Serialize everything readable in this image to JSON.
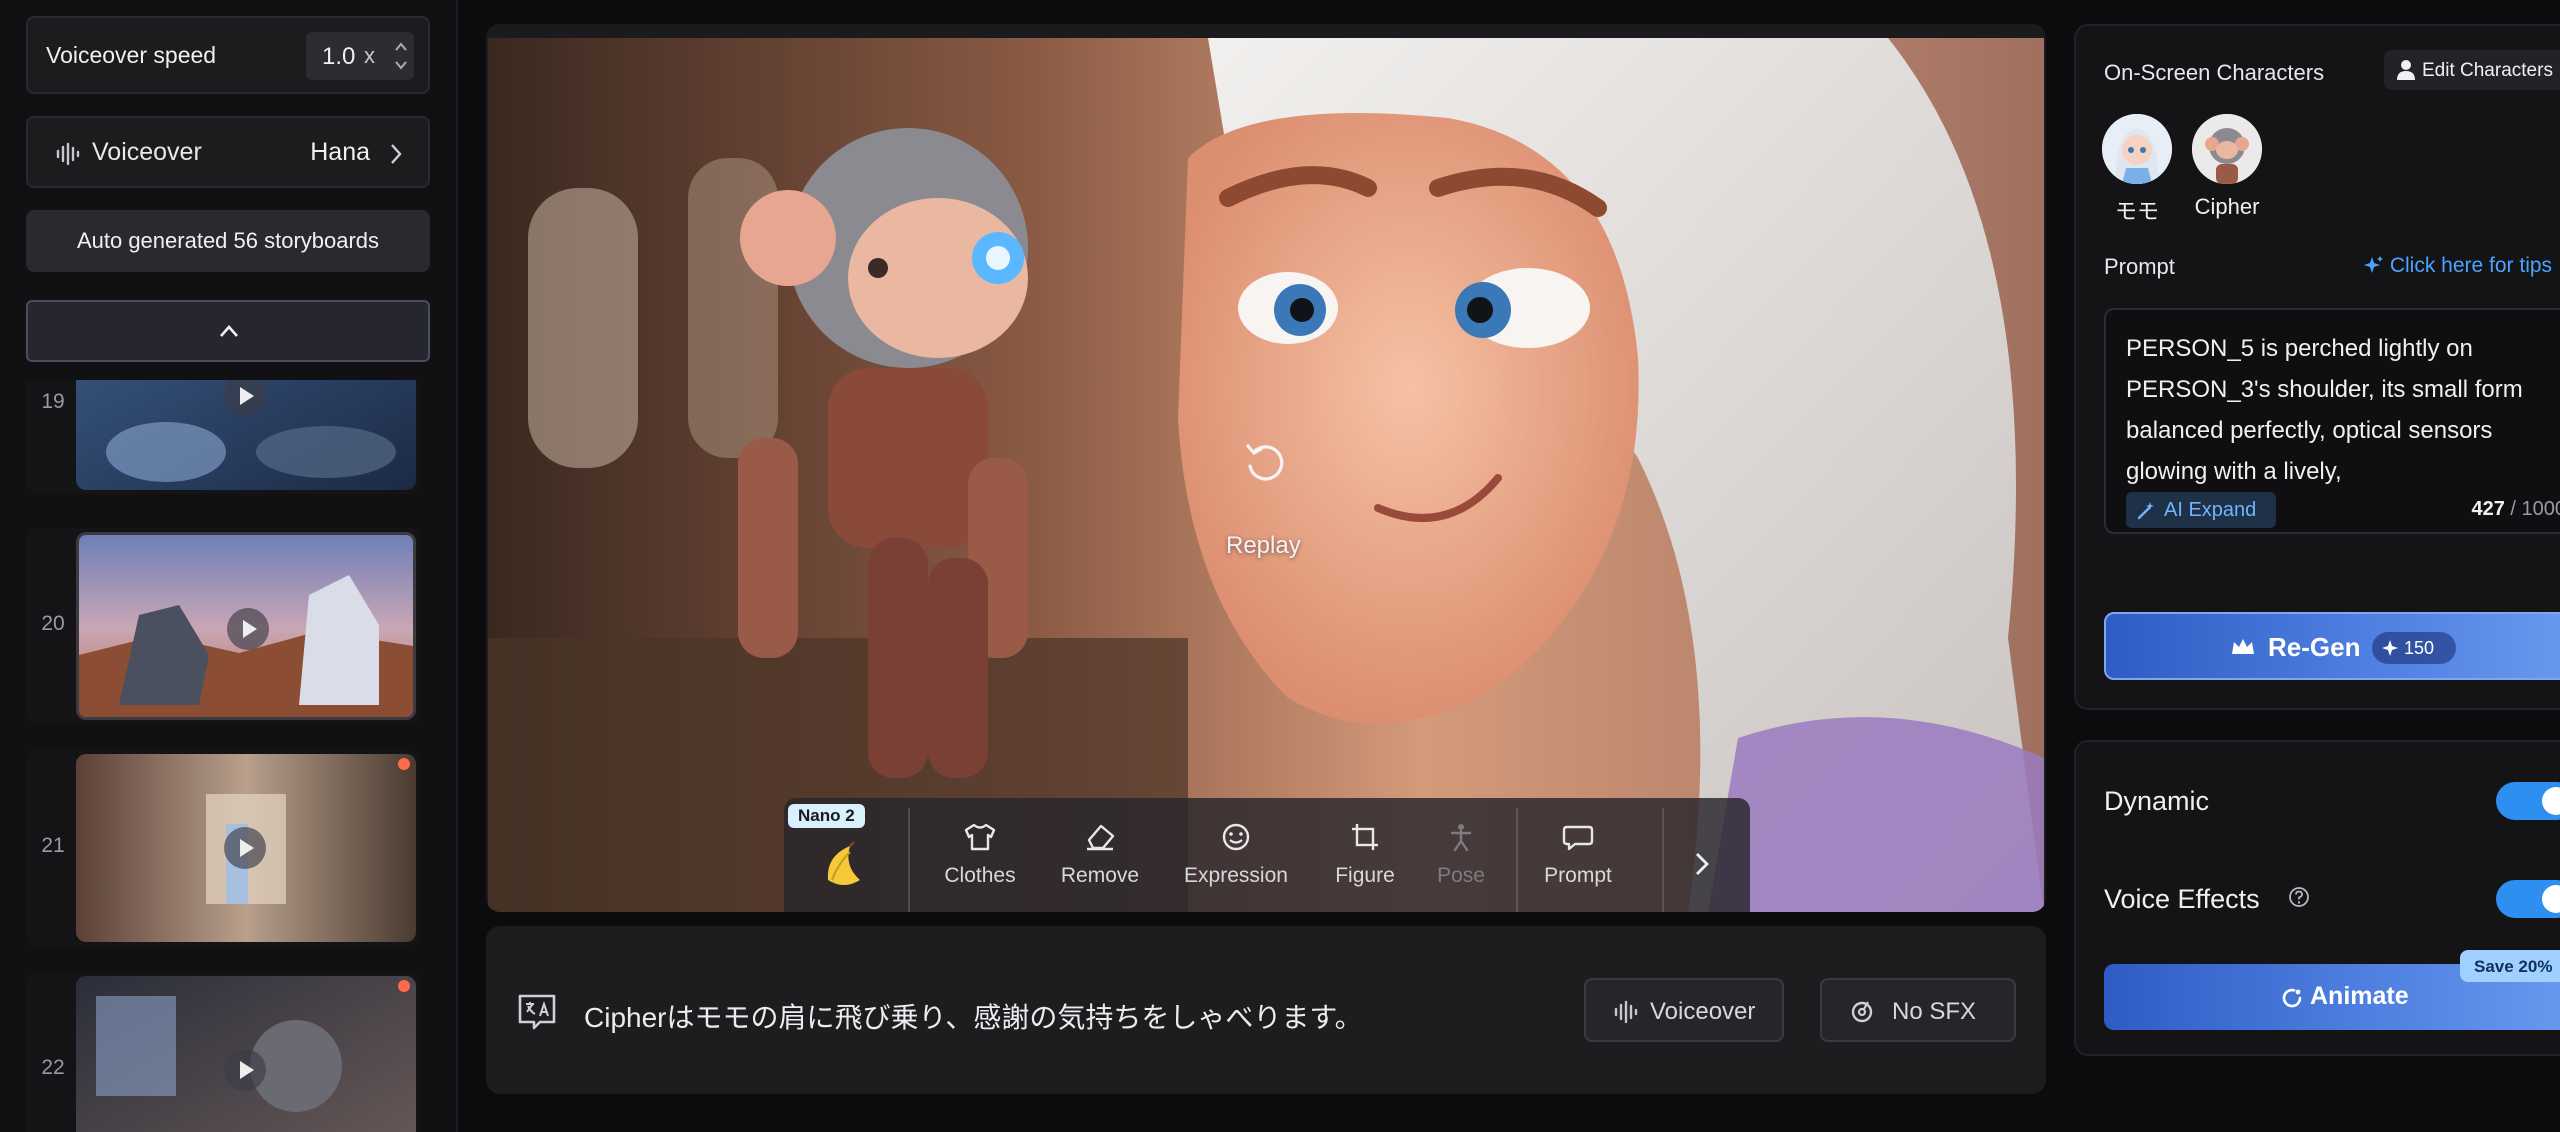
{
  "left_panel": {
    "speed": {
      "label": "Voiceover speed",
      "value": "1.0",
      "unit": "x"
    },
    "voiceover": {
      "label": "Voiceover",
      "value": "Hana"
    },
    "auto_generated_label": "Auto generated 56 storyboards",
    "storyboards": [
      {
        "number": "19",
        "flagged": false
      },
      {
        "number": "20",
        "flagged": false
      },
      {
        "number": "21",
        "flagged": true
      },
      {
        "number": "22",
        "flagged": true
      }
    ]
  },
  "preview": {
    "replay_label": "Replay",
    "toolbar": {
      "model_badge": "Nano 2",
      "tools": [
        {
          "label": "Clothes",
          "icon": "shirt-icon",
          "enabled": true
        },
        {
          "label": "Remove",
          "icon": "eraser-icon",
          "enabled": true
        },
        {
          "label": "Expression",
          "icon": "smile-icon",
          "enabled": true
        },
        {
          "label": "Figure",
          "icon": "figure-crop-icon",
          "enabled": true
        },
        {
          "label": "Pose",
          "icon": "pose-icon",
          "enabled": false
        },
        {
          "label": "Prompt",
          "icon": "speech-bubble-icon",
          "enabled": true
        }
      ]
    }
  },
  "caption": {
    "text": "Cipherはモモの肩に飛び乗り、感謝の気持ちをしゃべります。",
    "voiceover_button": "Voiceover",
    "sfx_button": "No SFX"
  },
  "right_panel": {
    "characters_title": "On-Screen Characters",
    "edit_characters": "Edit Characters",
    "characters": [
      {
        "name": "モモ"
      },
      {
        "name": "Cipher"
      }
    ],
    "prompt_label": "Prompt",
    "tips_link": "Click here for tips",
    "prompt_text": "PERSON_5 is perched lightly on PERSON_3's shoulder, its small form balanced perfectly, optical sensors glowing with a lively,",
    "ai_expand": "AI Expand",
    "char_count": "427",
    "char_max": "/ 1000",
    "regen": {
      "label": "Re-Gen",
      "cost": "150"
    },
    "options": [
      {
        "label": "Dynamic",
        "enabled": true
      },
      {
        "label": "Voice Effects",
        "enabled": true
      }
    ],
    "animate": {
      "label": "Animate",
      "badge": "Save 20%"
    }
  },
  "colors": {
    "accent_blue": "#2d8ff0",
    "link_blue": "#4aa3ff",
    "flag_red": "#ff6b4a",
    "background": "#0c0c0e"
  }
}
